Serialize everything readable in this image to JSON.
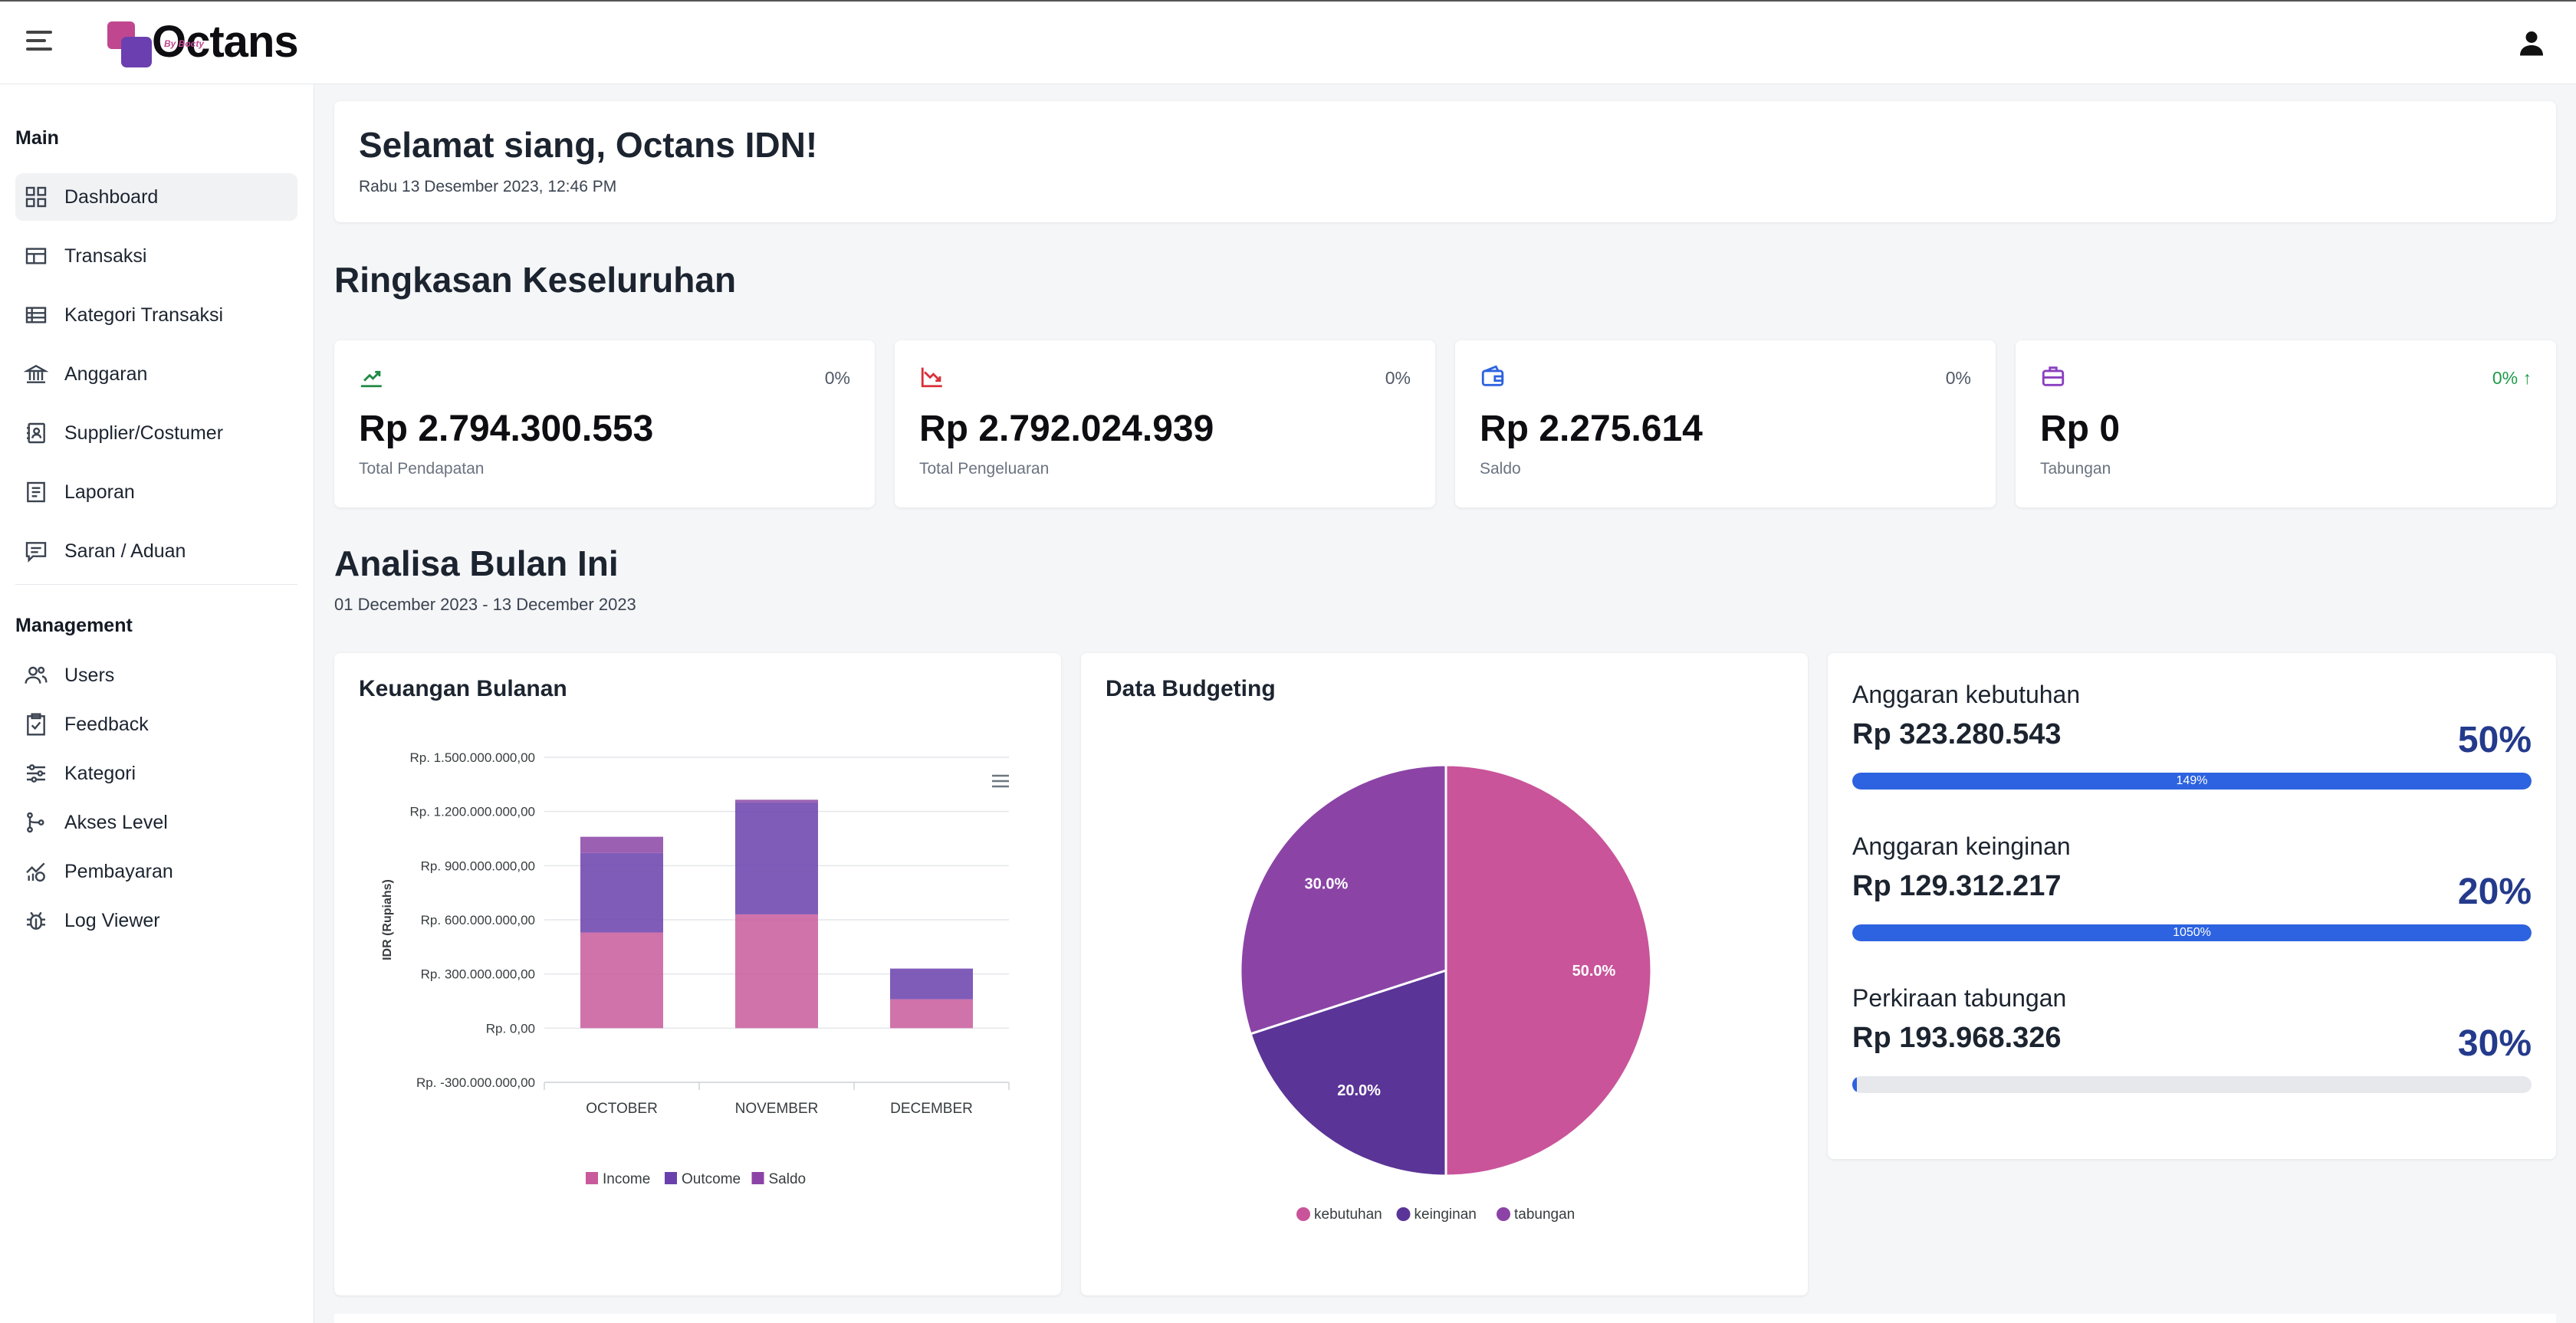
{
  "app": {
    "logo_text": "Octans",
    "logo_sub": "By Bocty"
  },
  "sidebar": {
    "main_title": "Main",
    "main_items": [
      {
        "label": "Dashboard",
        "icon": "dashboard-icon"
      },
      {
        "label": "Transaksi",
        "icon": "table-icon"
      },
      {
        "label": "Kategori Transaksi",
        "icon": "list-table-icon"
      },
      {
        "label": "Anggaran",
        "icon": "bank-icon"
      },
      {
        "label": "Supplier/Costumer",
        "icon": "contacts-icon"
      },
      {
        "label": "Laporan",
        "icon": "report-icon"
      },
      {
        "label": "Saran / Aduan",
        "icon": "message-icon"
      }
    ],
    "mgmt_title": "Management",
    "mgmt_items": [
      {
        "label": "Users",
        "icon": "users-icon"
      },
      {
        "label": "Feedback",
        "icon": "clipboard-icon"
      },
      {
        "label": "Kategori",
        "icon": "sliders-icon"
      },
      {
        "label": "Akses Level",
        "icon": "branch-icon"
      },
      {
        "label": "Pembayaran",
        "icon": "payment-icon"
      },
      {
        "label": "Log Viewer",
        "icon": "bug-icon"
      }
    ]
  },
  "greeting": {
    "title": "Selamat siang, Octans IDN!",
    "date": "Rabu 13 Desember 2023, 12:46 PM"
  },
  "summary": {
    "title": "Ringkasan Keseluruhan",
    "cards": [
      {
        "value": "Rp 2.794.300.553",
        "label": "Total Pendapatan",
        "pct": "0%",
        "icon": "trending-up-icon",
        "color": "#1f8a45"
      },
      {
        "value": "Rp 2.792.024.939",
        "label": "Total Pengeluaran",
        "pct": "0%",
        "icon": "trending-down-icon",
        "color": "#d8313a"
      },
      {
        "value": "Rp 2.275.614",
        "label": "Saldo",
        "pct": "0%",
        "icon": "wallet-icon",
        "color": "#2d63e0"
      },
      {
        "value": "Rp 0",
        "label": "Tabungan",
        "pct": "0% ↑",
        "icon": "briefcase-icon",
        "color": "#8a3fc0"
      }
    ]
  },
  "analysis": {
    "title": "Analisa Bulan Ini",
    "range": "01 December 2023 - 13 December 2023"
  },
  "colors": {
    "income": "#c85a9c",
    "outcome": "#6a40ad",
    "saldo": "#8b44a6",
    "primary": "#2d63e0"
  },
  "chart_data": [
    {
      "type": "bar",
      "title": "Keuangan Bulanan",
      "stacked": true,
      "ylabel": "IDR (Rupiahs)",
      "xlabel": "",
      "categories": [
        "OCTOBER",
        "NOVEMBER",
        "DECEMBER"
      ],
      "ylim": [
        -300000000,
        1500000000
      ],
      "yticks": [
        "Rp. 1.500.000.000,00",
        "Rp. 1.200.000.000,00",
        "Rp. 900.000.000,00",
        "Rp. 600.000.000,00",
        "Rp. 300.000.000,00",
        "Rp. 0,00",
        "Rp. -300.000.000,00"
      ],
      "series": [
        {
          "name": "Income",
          "values": [
            530000000,
            630000000,
            160000000
          ]
        },
        {
          "name": "Outcome",
          "values": [
            440000000,
            620000000,
            170000000
          ]
        },
        {
          "name": "Saldo",
          "values": [
            90000000,
            15000000,
            0
          ]
        }
      ],
      "grid": true,
      "legend": "bottom"
    },
    {
      "type": "pie",
      "title": "Data Budgeting",
      "categories": [
        "kebutuhan",
        "keinginan",
        "tabungan"
      ],
      "values": [
        50.0,
        20.0,
        30.0
      ],
      "labels": [
        "50.0%",
        "20.0%",
        "30.0%"
      ],
      "legend": "bottom"
    }
  ],
  "budget": [
    {
      "title": "Anggaran kebutuhan",
      "value": "Rp 323.280.543",
      "pct": "50%",
      "bar_label": "149%",
      "fill": 1.0
    },
    {
      "title": "Anggaran keinginan",
      "value": "Rp 129.312.217",
      "pct": "20%",
      "bar_label": "1050%",
      "fill": 1.0
    },
    {
      "title": "Perkiraan tabungan",
      "value": "Rp 193.968.326",
      "pct": "30%",
      "bar_label": "",
      "fill": 0.0
    }
  ]
}
